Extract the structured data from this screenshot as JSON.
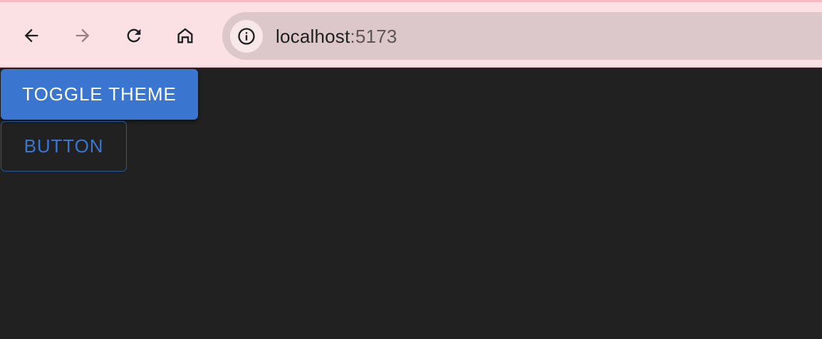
{
  "browser": {
    "url_host": "localhost",
    "url_port": ":5173",
    "icons": {
      "back": "arrow-left-icon",
      "forward": "arrow-right-icon",
      "reload": "reload-icon",
      "home": "home-icon",
      "site_info": "info-icon"
    },
    "colors": {
      "toolbar_bg": "#fbe0e4",
      "omnibox_bg": "#dcc7ca",
      "forward_disabled": "#9a7f85"
    }
  },
  "page": {
    "background": "#212121",
    "toggle_theme_label": "TOGGLE THEME",
    "button_label": "BUTTON",
    "accent": "#3a76d0"
  }
}
